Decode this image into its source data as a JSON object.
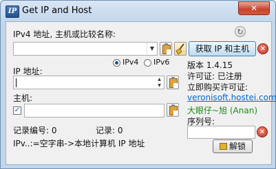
{
  "window": {
    "title": "Get IP and Host",
    "icon_letters": "IP",
    "close_glyph": "✕"
  },
  "host_section": {
    "label": "IPv4 地址, 主机或比较名称:",
    "input_value": "",
    "get_button": "获取 IP 和主机"
  },
  "mode": {
    "ipv4": "IPv4",
    "ipv6": "IPv6",
    "selected": "IPv4"
  },
  "ip_section": {
    "label": "IP 地址:",
    "value": ""
  },
  "host_field": {
    "label": "主机:",
    "value": "",
    "checked": true,
    "check_glyph": "✓"
  },
  "counts": {
    "record_no_label": "记录编号: 0",
    "record_label": "记录: 0"
  },
  "hint": "IPv..:=空字串->本地计算机 IP 地址",
  "info": {
    "version": "版本 1.4.15",
    "license": "许可证: 已注册",
    "buy": "立即购买许可证:",
    "url": "veronisoft.hostei.com",
    "user": "大眼仔~旭 (Anan)",
    "serial_label": "序列号:"
  },
  "serial": {
    "value": "",
    "unlock_button": "解锁"
  },
  "icons": {
    "refresh": "↻",
    "remove": "✕",
    "spin_up": "▲",
    "spin_down": "▼",
    "combo": "▼"
  }
}
